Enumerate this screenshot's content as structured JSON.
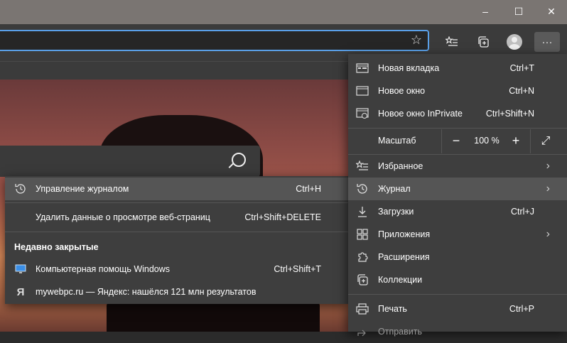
{
  "window": {
    "minimize": "–",
    "maximize": "☐",
    "close": "✕"
  },
  "toolbar": {
    "address_value": "",
    "favorite_star": "☆",
    "more": "···"
  },
  "main_menu": {
    "new_tab": {
      "label": "Новая вкладка",
      "shortcut": "Ctrl+T"
    },
    "new_window": {
      "label": "Новое окно",
      "shortcut": "Ctrl+N"
    },
    "new_inprivate": {
      "label": "Новое окно InPrivate",
      "shortcut": "Ctrl+Shift+N"
    },
    "zoom": {
      "label": "Масштаб",
      "minus": "−",
      "value": "100 %",
      "plus": "+",
      "fullscreen": "⤢"
    },
    "favorites": {
      "label": "Избранное"
    },
    "history": {
      "label": "Журнал"
    },
    "downloads": {
      "label": "Загрузки",
      "shortcut": "Ctrl+J"
    },
    "apps": {
      "label": "Приложения"
    },
    "extensions": {
      "label": "Расширения"
    },
    "collections": {
      "label": "Коллекции"
    },
    "print": {
      "label": "Печать",
      "shortcut": "Ctrl+P"
    },
    "share": {
      "label": "Отправить"
    }
  },
  "history_menu": {
    "manage": {
      "label": "Управление журналом",
      "shortcut": "Ctrl+H"
    },
    "clear": {
      "label": "Удалить данные о просмотре веб-страниц",
      "shortcut": "Ctrl+Shift+DELETE"
    },
    "recently_closed_heading": "Недавно закрытые",
    "recent": [
      {
        "label": "Компьютерная помощь Windows",
        "shortcut": "Ctrl+Shift+T"
      },
      {
        "label": "mywebpc.ru — Яндекс: нашёлся 121 млн результатов",
        "shortcut": ""
      }
    ],
    "yandex_glyph": "Я"
  },
  "colors": {
    "accent": "#5aa0e8",
    "menu_bg": "#3e3e3e",
    "highlight": "#555555"
  }
}
